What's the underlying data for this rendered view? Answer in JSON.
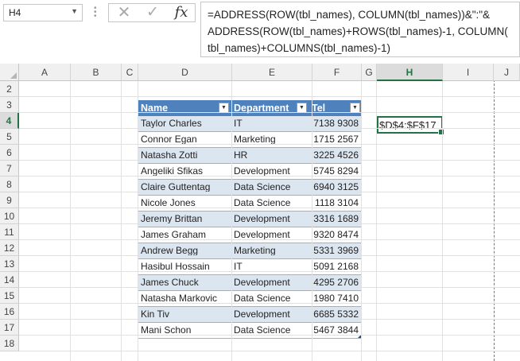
{
  "formula_bar": {
    "name_box": "H4",
    "formula_lines": [
      "=ADDRESS(ROW(tbl_names), COLUMN(tbl_names))&\":\"&",
      "ADDRESS(ROW(tbl_names)+ROWS(tbl_names)-1, COLUMN(",
      "tbl_names)+COLUMNS(tbl_names)-1)"
    ],
    "fx_label": "fx",
    "cancel_glyph": "✕",
    "enter_glyph": "✓"
  },
  "columns": [
    "A",
    "B",
    "C",
    "D",
    "E",
    "F",
    "G",
    "H",
    "I",
    "J"
  ],
  "rows": [
    "2",
    "3",
    "4",
    "5",
    "6",
    "7",
    "8",
    "9",
    "10",
    "11",
    "12",
    "13",
    "14",
    "15",
    "16",
    "17",
    "18"
  ],
  "active_cell": {
    "ref": "H4",
    "value": "$D$4:$F$17"
  },
  "table": {
    "name": "tbl_names",
    "headers": [
      "Name",
      "Department",
      "Tel"
    ],
    "rows": [
      {
        "name": "Taylor Charles",
        "department": "IT",
        "tel": "7138 9308"
      },
      {
        "name": "Connor Egan",
        "department": "Marketing",
        "tel": "1715 2567"
      },
      {
        "name": "Natasha Zotti",
        "department": "HR",
        "tel": "3225 4526"
      },
      {
        "name": "Angeliki Sfikas",
        "department": "Development",
        "tel": "5745 8294"
      },
      {
        "name": "Claire Guttentag",
        "department": "Data Science",
        "tel": "6940 3125"
      },
      {
        "name": "Nicole Jones",
        "department": "Data Science",
        "tel": "1118 3104"
      },
      {
        "name": "Jeremy Brittan",
        "department": "Development",
        "tel": "3316 1689"
      },
      {
        "name": "James Graham",
        "department": "Development",
        "tel": "9320 8474"
      },
      {
        "name": "Andrew Begg",
        "department": "Marketing",
        "tel": "5331 3969"
      },
      {
        "name": "Hasibul Hossain",
        "department": "IT",
        "tel": "5091 2168"
      },
      {
        "name": "James Chuck",
        "department": "Development",
        "tel": "4295 2706"
      },
      {
        "name": "Natasha Markovic",
        "department": "Data Science",
        "tel": "1980 7410"
      },
      {
        "name": "Kin Tiv",
        "department": "Development",
        "tel": "6685 5332"
      },
      {
        "name": "Mani Schon",
        "department": "Data Science",
        "tel": "5467 3844"
      }
    ]
  },
  "colors": {
    "header_fill": "#4f81bd",
    "band_fill": "#dce6f1",
    "selection": "#217346"
  }
}
